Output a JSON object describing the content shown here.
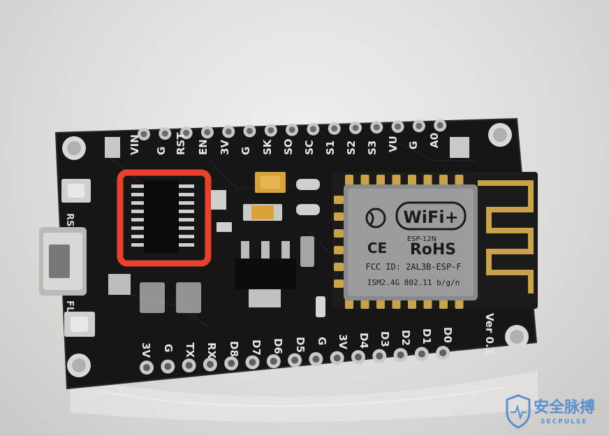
{
  "header_silkscreen": [
    "VIN",
    "G",
    "RST",
    "EN",
    "3V",
    "G",
    "SK",
    "SO",
    "SC",
    "S1",
    "S2",
    "S3",
    "VU",
    "G",
    "A0"
  ],
  "footer_silkscreen": [
    "3V",
    "G",
    "TX",
    "RX",
    "D8",
    "D7",
    "D6",
    "D5",
    "G",
    "3V",
    "D4",
    "D3",
    "D2",
    "D1",
    "D0"
  ],
  "left_labels": {
    "rst": "RST",
    "flash": "FLASH"
  },
  "version": "Ver 0.1",
  "module": {
    "brand": "WiFi+",
    "model": "ESP-12N",
    "rohs": "RoHS",
    "ce": "CE",
    "fcc": "FCC ID: 2AL3B-ESP-F",
    "band": "ISM2.4G  802.11 b/g/n"
  },
  "watermark": {
    "title": "安全脉搏",
    "subtitle": "SECPULSE"
  },
  "colors": {
    "pcb": "#141414",
    "highlight": "#e8422c",
    "gold": "#c9a24a",
    "watermark": "#5a8fd0"
  }
}
